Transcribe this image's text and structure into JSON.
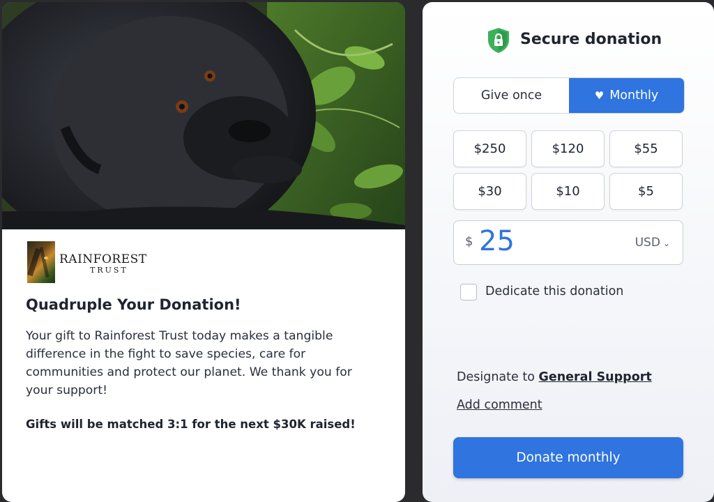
{
  "left": {
    "logo": {
      "name": "RAINFOREST",
      "sub": "TRUST"
    },
    "headline": "Quadruple Your Donation!",
    "body": "Your gift to Rainforest Trust today makes a tangible difference in the fight to save species, care for communities and protect our planet. We thank you for your support!",
    "match": "Gifts will be matched 3:1 for the next $30K raised!"
  },
  "right": {
    "title": "Secure donation",
    "shield_icon": "lock-shield-icon",
    "frequency": {
      "once": "Give once",
      "monthly": "Monthly",
      "selected": "Monthly"
    },
    "amounts": [
      "$250",
      "$120",
      "$55",
      "$30",
      "$10",
      "$5"
    ],
    "amount_input": {
      "symbol": "$",
      "value": "25",
      "currency": "USD"
    },
    "dedicate_label": "Dedicate this donation",
    "designate": {
      "prefix": "Designate to",
      "link": "General Support"
    },
    "add_comment": "Add comment",
    "donate_button": "Donate monthly"
  },
  "colors": {
    "accent": "#2f74df",
    "shield": "#3db05a"
  }
}
